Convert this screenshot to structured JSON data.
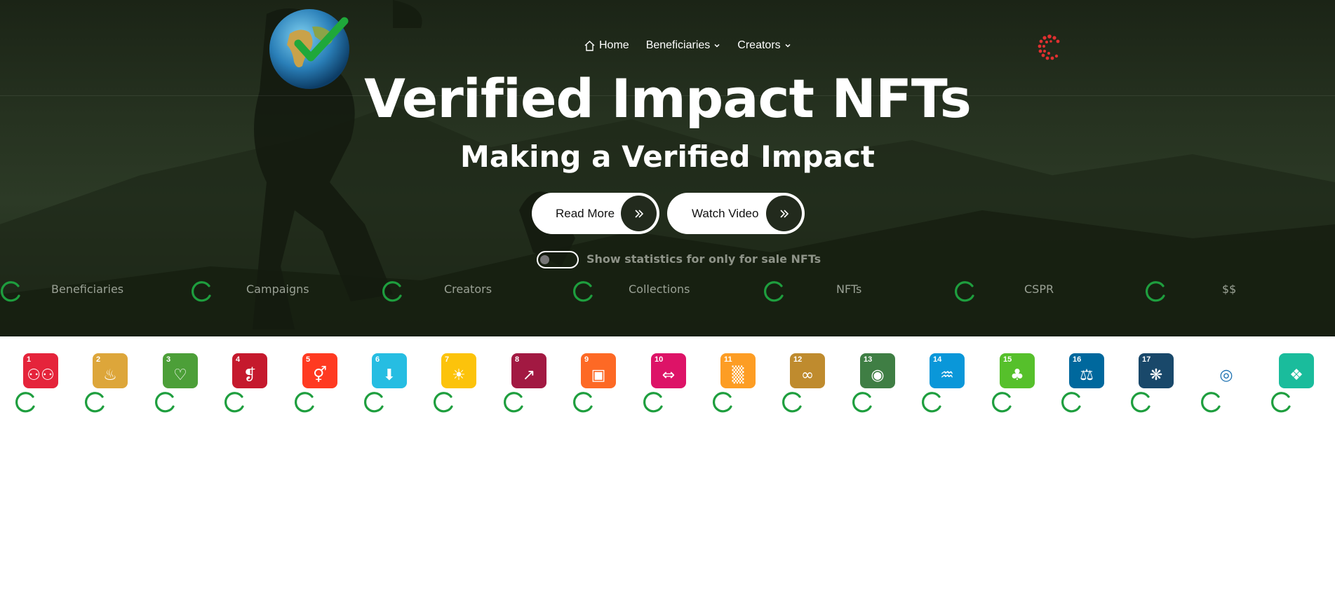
{
  "nav": {
    "home_label": "Home",
    "beneficiaries_label": "Beneficiaries",
    "creators_label": "Creators"
  },
  "hero": {
    "title": "Verified Impact NFTs",
    "subtitle": "Making a Verified Impact",
    "read_more_label": "Read More",
    "watch_video_label": "Watch Video",
    "toggle_label": "Show statistics for only for sale NFTs",
    "toggle_on": false
  },
  "stats": [
    {
      "label": "Beneficiaries"
    },
    {
      "label": "Campaigns"
    },
    {
      "label": "Creators"
    },
    {
      "label": "Collections"
    },
    {
      "label": "NFTs"
    },
    {
      "label": "CSPR"
    },
    {
      "label": "$$"
    }
  ],
  "sdg_goals": [
    {
      "number": "1",
      "color": "#e5243b",
      "icon": "people-icon"
    },
    {
      "number": "2",
      "color": "#dda63a",
      "icon": "bowl-icon"
    },
    {
      "number": "3",
      "color": "#4c9f38",
      "icon": "heartbeat-icon"
    },
    {
      "number": "4",
      "color": "#c5192d",
      "icon": "book-icon"
    },
    {
      "number": "5",
      "color": "#ff3a21",
      "icon": "gender-icon"
    },
    {
      "number": "6",
      "color": "#26bde2",
      "icon": "water-icon"
    },
    {
      "number": "7",
      "color": "#fcc30b",
      "icon": "sun-icon"
    },
    {
      "number": "8",
      "color": "#a21942",
      "icon": "growth-chart-icon"
    },
    {
      "number": "9",
      "color": "#fd6925",
      "icon": "cubes-icon"
    },
    {
      "number": "10",
      "color": "#dd1367",
      "icon": "equality-icon"
    },
    {
      "number": "11",
      "color": "#fd9d24",
      "icon": "city-icon"
    },
    {
      "number": "12",
      "color": "#bf8b2e",
      "icon": "infinity-icon"
    },
    {
      "number": "13",
      "color": "#3f7e44",
      "icon": "eye-globe-icon"
    },
    {
      "number": "14",
      "color": "#0a97d9",
      "icon": "fish-icon"
    },
    {
      "number": "15",
      "color": "#56c02b",
      "icon": "tree-icon"
    },
    {
      "number": "16",
      "color": "#00689d",
      "icon": "dove-icon"
    },
    {
      "number": "17",
      "color": "#19486a",
      "icon": "flower-icon"
    },
    {
      "number": "",
      "color": "#ffffff",
      "icon": "sdg-wheel-icon"
    },
    {
      "number": "",
      "color": "#1abc9c",
      "icon": "shapes-icon"
    }
  ],
  "colors": {
    "spinner_green": "#1e9e3e",
    "spinner_red": "#e03030",
    "hero_bg": "#263220"
  }
}
